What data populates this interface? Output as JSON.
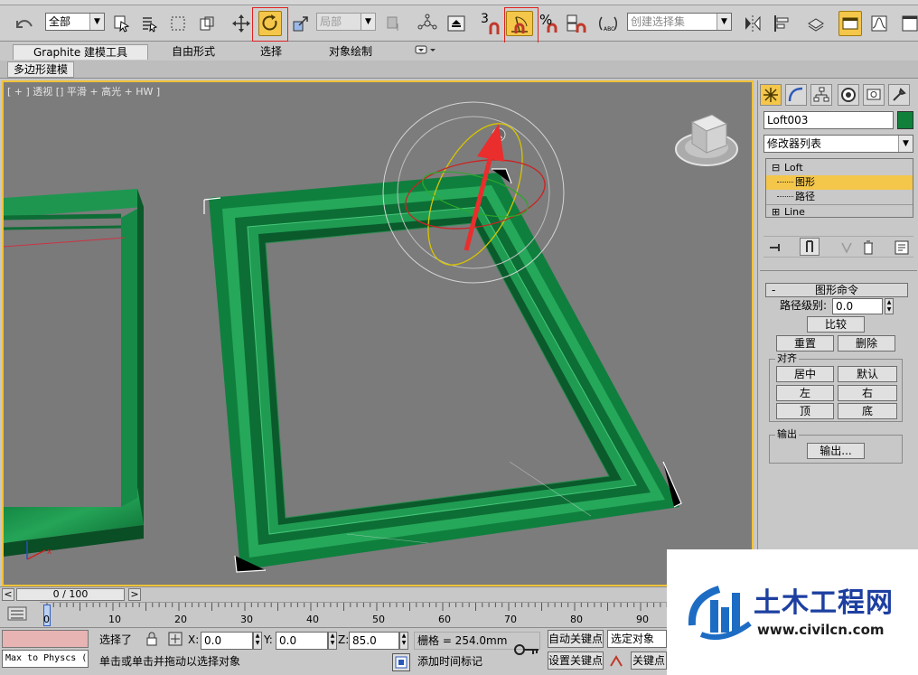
{
  "toolbar": {
    "filter_select": "全部",
    "ref_coord_select": "局部",
    "named_selection": "创建选择集",
    "snap_angle_label": "3",
    "percent_label": "%"
  },
  "ribbon": {
    "tabs": [
      "Graphite 建模工具",
      "自由形式",
      "选择",
      "对象绘制"
    ],
    "subtab": "多边形建模"
  },
  "viewport": {
    "label": "[ + ] 透视 [] 平滑 + 高光 + HW ]"
  },
  "command_panel": {
    "object_name": "Loft003",
    "object_color": "#10803a",
    "modifier_list": "修改器列表",
    "stack": [
      {
        "label": "Loft",
        "expander": "⊟",
        "highlighted": false
      },
      {
        "label": "图形",
        "expander": "",
        "highlighted": true
      },
      {
        "label": "路径",
        "expander": "",
        "highlighted": false
      },
      {
        "label": "Line",
        "expander": "⊞",
        "highlighted": false
      }
    ],
    "rollout_minus": "-",
    "rollout_title": "图形命令",
    "path_level_label": "路径级别:",
    "path_level_value": "0.0",
    "compare_button": "比较",
    "reset_button": "重置",
    "delete_button": "删除",
    "align_group": "对齐",
    "center_button": "居中",
    "default_button": "默认",
    "left_button": "左",
    "right_button": "右",
    "top_button": "顶",
    "bottom_button": "底",
    "output_group": "输出",
    "output_button": "输出..."
  },
  "timeline": {
    "frame_display": "0 / 100",
    "left_arrow": "<",
    "right_arrow": ">",
    "ticks": [
      "0",
      "10",
      "20",
      "30",
      "40",
      "50",
      "60",
      "70",
      "80",
      "90"
    ]
  },
  "status": {
    "selected_label": "选择了",
    "x_label": "X:",
    "x_value": "0.0",
    "y_label": "Y:",
    "y_value": "0.0",
    "z_label": "Z:",
    "z_value": "85.0",
    "grid_label": "栅格 = 254.0mm",
    "auto_key": "自动关键点",
    "selected_object": "选定对象",
    "set_key": "设置关键点",
    "key_filter": "关键点",
    "prompt": "单击或单击并拖动以选择对象",
    "add_time_tag": "添加时间标记",
    "script_box": "Max to Physcs ("
  },
  "watermark": {
    "title": "土木工程网",
    "url": "www.civilcn.com"
  }
}
